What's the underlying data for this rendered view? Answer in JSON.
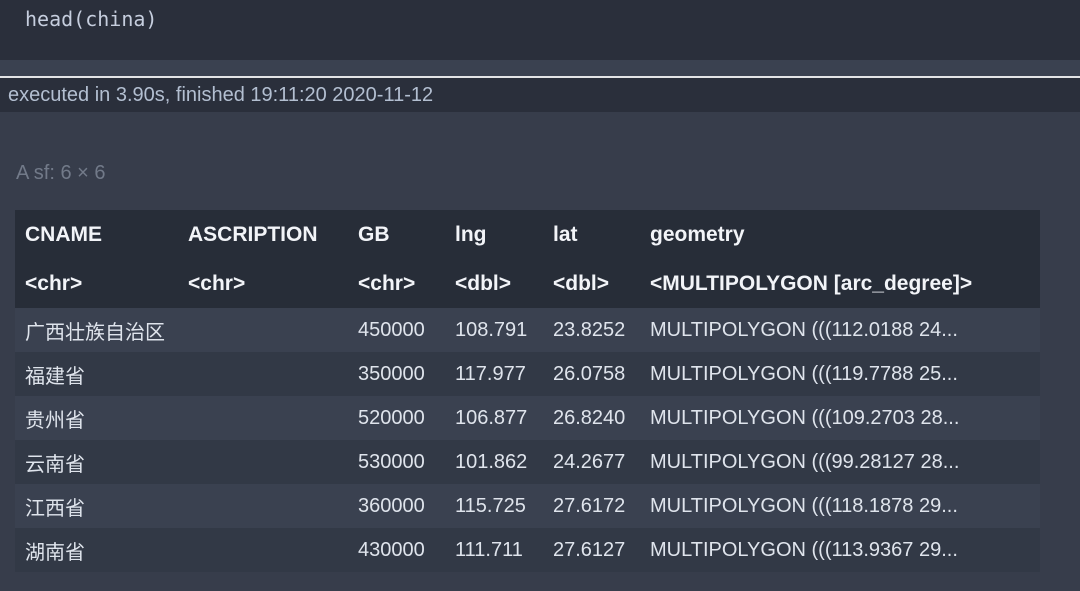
{
  "code_cell": {
    "source": "head(china)"
  },
  "status_bar": {
    "text": "executed in 3.90s, finished 19:11:20 2020-11-12"
  },
  "output": {
    "caption": "A sf: 6 × 6",
    "table": {
      "columns": [
        {
          "label": "CNAME",
          "type": "<chr>"
        },
        {
          "label": "ASCRIPTION",
          "type": "<chr>"
        },
        {
          "label": "GB",
          "type": "<chr>"
        },
        {
          "label": "lng",
          "type": "<dbl>"
        },
        {
          "label": "lat",
          "type": "<dbl>"
        },
        {
          "label": "geometry",
          "type": "<MULTIPOLYGON [arc_degree]>"
        }
      ],
      "rows": [
        [
          "广西壮族自治区",
          "",
          "450000",
          "108.791",
          "23.8252",
          "MULTIPOLYGON (((112.0188 24..."
        ],
        [
          "福建省",
          "",
          "350000",
          "117.977",
          "26.0758",
          "MULTIPOLYGON (((119.7788 25..."
        ],
        [
          "贵州省",
          "",
          "520000",
          "106.877",
          "26.8240",
          "MULTIPOLYGON (((109.2703 28..."
        ],
        [
          "云南省",
          "",
          "530000",
          "101.862",
          "24.2677",
          "MULTIPOLYGON (((99.28127 28..."
        ],
        [
          "江西省",
          "",
          "360000",
          "115.725",
          "27.6172",
          "MULTIPOLYGON (((118.1878 29..."
        ],
        [
          "湖南省",
          "",
          "430000",
          "111.711",
          "27.6127",
          "MULTIPOLYGON (((113.9367 29..."
        ]
      ]
    }
  },
  "colors": {
    "page_bg": "#373d4b",
    "panel_bg": "#2a2f3b",
    "gap_band": "#3a4150",
    "divider": "#e3e4e6",
    "header_bg": "#272d38",
    "row_odd": "#3a4150",
    "row_even": "#323946",
    "header_text": "#f2f4f8",
    "body_text": "#dfe4ec",
    "muted_text": "#727a89",
    "code_text": "#c6cede",
    "status_text": "#b3bfd1"
  }
}
